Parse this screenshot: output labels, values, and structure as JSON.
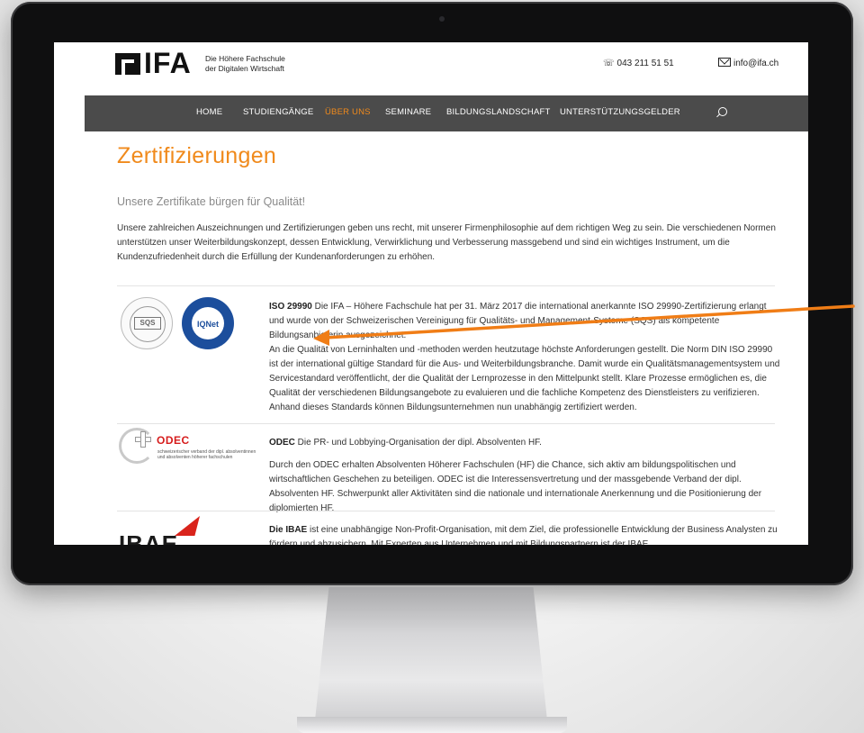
{
  "header": {
    "logo_text": "IFA",
    "logo_sub_1": "Die Höhere Fachschule",
    "logo_sub_2": "der Digitalen Wirtschaft",
    "phone": "043 211 51 51",
    "email": "info@ifa.ch"
  },
  "nav": {
    "items": [
      "HOME",
      "STUDIENGÄNGE",
      "ÜBER UNS",
      "SEMINARE",
      "BILDUNGSLANDSCHAFT",
      "UNTERSTÜTZUNGSGELDER"
    ],
    "active": "ÜBER UNS",
    "search_icon": "search-icon"
  },
  "page": {
    "title": "Zertifizierungen",
    "subtitle": "Unsere Zertifikate bürgen für Qualität!",
    "intro": "Unsere zahlreichen Auszeichnungen und Zertifizierungen geben uns recht, mit unserer Firmenphilosophie auf dem richtigen Weg zu sein. Die verschiedenen Normen unterstützen unser Weiterbildungskonzept, dessen Entwicklung, Verwirklichung und Verbesserung massgebend und sind ein wichtiges Instrument, um die Kundenzufriedenheit durch die Erfüllung der Kundenanforderungen zu erhöhen."
  },
  "certs": [
    {
      "logo_a": "SQS",
      "logo_b": "IQNet",
      "heading": "ISO 29990",
      "p1": " Die IFA – Höhere Fachschule hat per 31. März 2017 die international anerkannte ISO 29990-Zertifizierung erlangt und wurde von der Schweizerischen Vereinigung für Qualitäts- und Management-Systeme (SQS) als kompetente Bildungsanbieterin ausgezeichnet.",
      "p2": "An die Qualität von Lerninhalten und -methoden werden heutzutage höchste Anforderungen gestellt. Die Norm DIN ISO 29990 ist der international gültige Standard für die Aus- und Weiterbildungsbranche. Damit wurde ein Qualitätsmanagementsystem und Servicestandard veröffentlicht, der die Qualität der Lernprozesse in den Mittelpunkt stellt. Klare Prozesse ermöglichen es, die Qualität der verschiedenen Bildungsangebote zu evaluieren und die fachliche Kompetenz des Dienstleisters zu verifizieren. Anhand dieses Standards können Bildungsunternehmen nun unabhängig zertifiziert werden."
    },
    {
      "logo_name": "ODEC",
      "logo_tag": "schweizerischer verband der dipl. absolventinnen und absolventen höherer fachschulen",
      "heading": "ODEC",
      "p1": " Die PR- und Lobbying-Organisation der dipl. Absolventen HF.",
      "p2": "Durch den ODEC erhalten Absolventen Höherer Fachschulen (HF) die Chance, sich aktiv am bildungspolitischen und wirtschaftlichen Geschehen zu beteiligen. ODEC ist die Interessensvertretung und der massgebende Verband der dipl. Absolventen HF. Schwerpunkt aller Aktivitäten sind die nationale und internationale Anerkennung und die Positionierung der diplomierten HF."
    },
    {
      "logo_name": "IBAE",
      "heading": "Die IBAE",
      "p1": " ist eine unabhängige Non-Profit-Organisation, mit dem Ziel, die professionelle Entwicklung der Business Analysten zu fördern und abzusichern. Mit Experten aus Unternehmen und mit Bildungspartnern ist der IBAE"
    }
  ],
  "colors": {
    "accent": "#f08a1c",
    "nav_bg": "#4b4b4b",
    "arrow": "#f07d16"
  }
}
